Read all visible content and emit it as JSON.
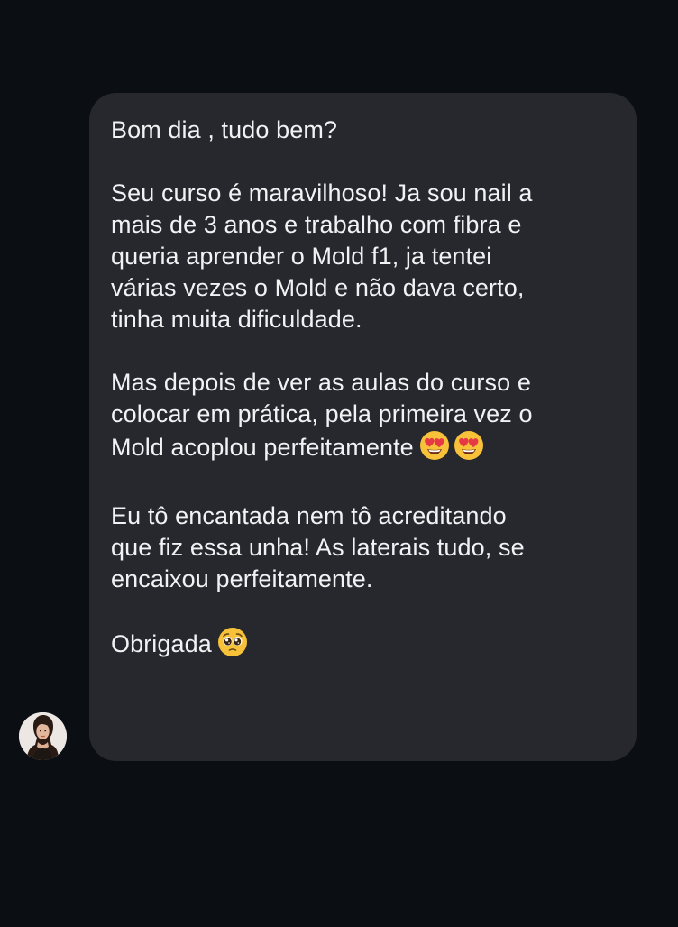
{
  "message": {
    "paragraphs": [
      "Bom dia , tudo bem?",
      "Seu curso é maravilhoso! Ja sou nail a\nmais de 3 anos e trabalho com fibra e\nqueria aprender o Mold f1, ja tentei\nvárias vezes o Mold e não dava certo,\ntinha muita dificuldade.",
      "Mas depois de ver as aulas do curso e\ncolocar em prática, pela primeira vez o\nMold acoplou perfeitamente",
      "Eu tô encantada nem tô acreditando\nque fiz essa unha! As laterais tudo, se\nencaixou perfeitamente.",
      "Obrigada"
    ],
    "emojis": {
      "paragraph_3": [
        "heart-eyes-emoji",
        "heart-eyes-emoji"
      ],
      "paragraph_5": [
        "pleading-face-emoji"
      ]
    }
  },
  "sender": {
    "avatar": "profile-photo-woman"
  },
  "colors": {
    "background": "#0b0e12",
    "bubble": "#26282e",
    "text": "#f2f2f4",
    "emoji_yellow": "#f7c23a"
  }
}
